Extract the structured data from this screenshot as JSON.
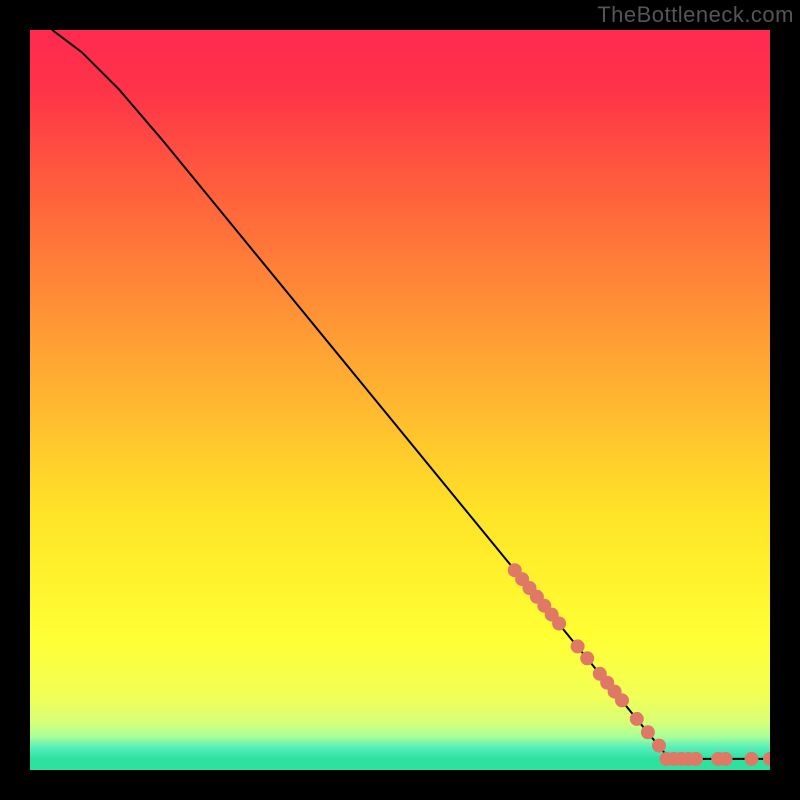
{
  "watermark": "TheBottleneck.com",
  "chart_data": {
    "type": "line",
    "title": "",
    "xlabel": "",
    "ylabel": "",
    "x_range": [
      0,
      100
    ],
    "y_range": [
      0,
      100
    ],
    "curve": {
      "description": "Single black curve descending from top-left to bottom-right; starts with slight curvature near top-left, then nearly linear diagonal, flattening to horizontal at bottom-right.",
      "points": [
        {
          "x": 3,
          "y": 100
        },
        {
          "x": 7,
          "y": 97
        },
        {
          "x": 12,
          "y": 92
        },
        {
          "x": 18,
          "y": 85
        },
        {
          "x": 86,
          "y": 2
        },
        {
          "x": 90,
          "y": 1.5
        },
        {
          "x": 100,
          "y": 1.5
        }
      ]
    },
    "scatter": {
      "description": "Salmon-colored round markers clustered on the lower-right portion of the curve and along the bottom flat segment.",
      "color": "#e07866",
      "radius": 7,
      "points": [
        {
          "x": 65.5,
          "y": 27.0
        },
        {
          "x": 66.5,
          "y": 25.8
        },
        {
          "x": 67.5,
          "y": 24.6
        },
        {
          "x": 68.5,
          "y": 23.4
        },
        {
          "x": 69.5,
          "y": 22.2
        },
        {
          "x": 70.5,
          "y": 21.0
        },
        {
          "x": 71.5,
          "y": 19.8
        },
        {
          "x": 74.0,
          "y": 16.7
        },
        {
          "x": 75.3,
          "y": 15.1
        },
        {
          "x": 77.0,
          "y": 13.0
        },
        {
          "x": 78.0,
          "y": 11.8
        },
        {
          "x": 79.0,
          "y": 10.6
        },
        {
          "x": 80.0,
          "y": 9.4
        },
        {
          "x": 82.0,
          "y": 6.9
        },
        {
          "x": 83.5,
          "y": 5.1
        },
        {
          "x": 85.0,
          "y": 3.3
        },
        {
          "x": 86.0,
          "y": 1.5
        },
        {
          "x": 87.0,
          "y": 1.5
        },
        {
          "x": 88.0,
          "y": 1.5
        },
        {
          "x": 89.0,
          "y": 1.5
        },
        {
          "x": 90.0,
          "y": 1.5
        },
        {
          "x": 93.0,
          "y": 1.5
        },
        {
          "x": 94.0,
          "y": 1.5
        },
        {
          "x": 97.5,
          "y": 1.5
        },
        {
          "x": 100.0,
          "y": 1.5
        }
      ]
    },
    "background": {
      "description": "Vertical gradient on plot area: red at top through orange and yellow to thin green band at bottom.",
      "stops": [
        {
          "offset": 0.0,
          "color": "#ff2a4f"
        },
        {
          "offset": 0.08,
          "color": "#ff3348"
        },
        {
          "offset": 0.25,
          "color": "#ff6a3a"
        },
        {
          "offset": 0.45,
          "color": "#ffa733"
        },
        {
          "offset": 0.65,
          "color": "#ffe327"
        },
        {
          "offset": 0.82,
          "color": "#ffff33"
        },
        {
          "offset": 0.9,
          "color": "#f2ff55"
        },
        {
          "offset": 0.935,
          "color": "#d8ff77"
        },
        {
          "offset": 0.955,
          "color": "#a8ff99"
        },
        {
          "offset": 0.97,
          "color": "#55eebb"
        },
        {
          "offset": 0.985,
          "color": "#2de29f"
        },
        {
          "offset": 1.0,
          "color": "#2de29f"
        }
      ]
    }
  }
}
